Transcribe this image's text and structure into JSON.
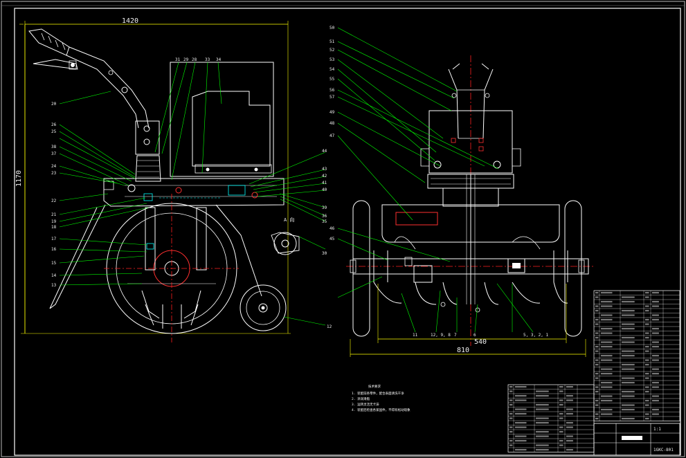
{
  "drawing": {
    "dim_width_side": "1420",
    "dim_height_side": "1170",
    "dim_track": "540",
    "dim_overall_width": "810",
    "view_label": "A 向",
    "title_block_code": "1GKC-801",
    "title_block_scale": "1:1"
  },
  "side_view_callouts": {
    "left": [
      "20",
      "26",
      "25",
      "38",
      "37",
      "24",
      "23",
      "22",
      "21",
      "19",
      "18",
      "17",
      "16",
      "15",
      "14",
      "13"
    ],
    "top": [
      "31",
      "29",
      "28",
      "33",
      "34"
    ],
    "right": [
      "44",
      "43",
      "42",
      "41",
      "40",
      "39",
      "36",
      "35"
    ],
    "bottom": [
      "11",
      "12",
      "30"
    ]
  },
  "front_view_callouts": {
    "left": [
      "50",
      "51",
      "52",
      "53",
      "54",
      "55",
      "56",
      "57",
      "49",
      "48",
      "47",
      "46",
      "45"
    ],
    "bottom": [
      "11",
      "12, 9, 8",
      "7",
      "6",
      "5, 3, 2, 1"
    ]
  },
  "notes": {
    "title": "技术要求",
    "items": [
      "1. 装配前各零件，配合表面清洗干净",
      "2. 涂润滑脂",
      "3. 运转灵活无卡滞",
      "4. 装配后检查各紧固件，不得有松动现象"
    ]
  },
  "colors": {
    "background": "#000000",
    "outline": "#ffffff",
    "frame": "#ffffff",
    "dimension": "#ffff00",
    "leader": "#00ff00",
    "centerline": "#ff2020",
    "hidden": "#00ffff",
    "fill_block": "#ffffff"
  }
}
